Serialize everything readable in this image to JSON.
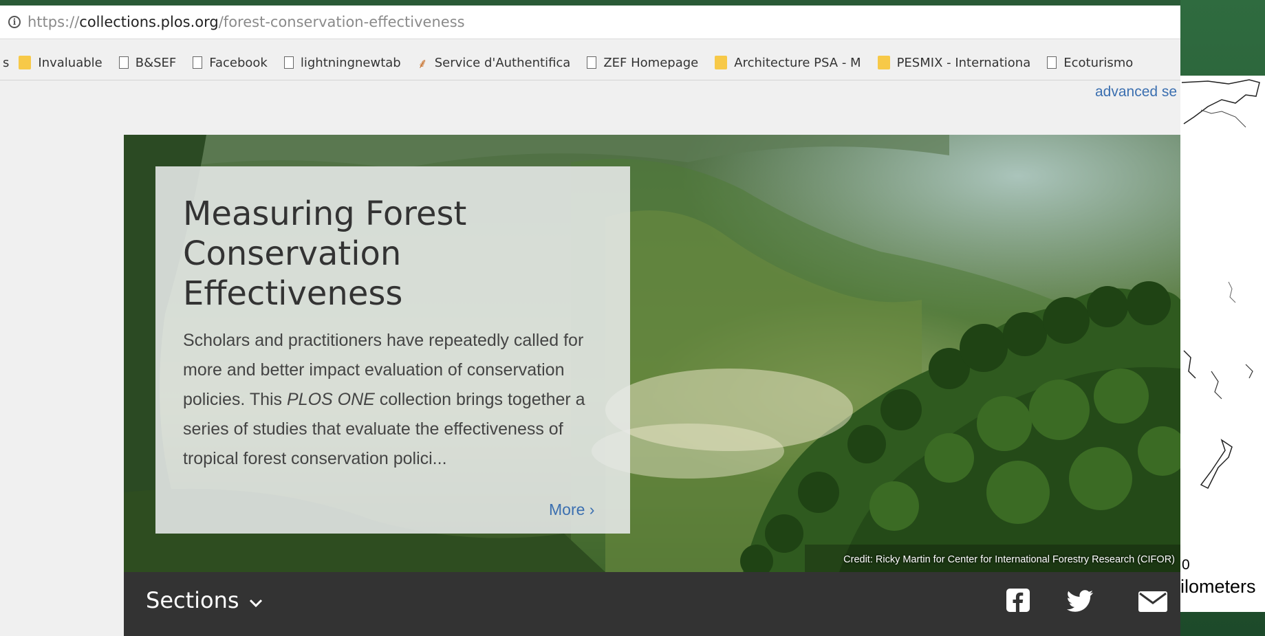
{
  "browser": {
    "url_scheme": "https://",
    "url_host": "collections.plos.org",
    "url_path": "/forest-conservation-effectiveness",
    "bookmarks": [
      {
        "label": "s",
        "icon": "none"
      },
      {
        "label": "Invaluable",
        "icon": "folder-icon"
      },
      {
        "label": "B&SEF",
        "icon": "page-icon"
      },
      {
        "label": "Facebook",
        "icon": "page-icon"
      },
      {
        "label": "lightningnewtab",
        "icon": "page-icon"
      },
      {
        "label": "Service d'Authentifica",
        "icon": "wheat-icon"
      },
      {
        "label": "ZEF Homepage",
        "icon": "page-icon"
      },
      {
        "label": "Architecture PSA - M",
        "icon": "folder-icon"
      },
      {
        "label": "PESMIX - Internationa",
        "icon": "folder-icon"
      },
      {
        "label": "Ecoturismo",
        "icon": "page-icon"
      }
    ]
  },
  "header": {
    "advanced_search": "advanced se"
  },
  "hero": {
    "title": "Measuring Forest Conservation Effectiveness",
    "body_before": "Scholars and practitioners have repeatedly called for more and better impact evaluation of conservation policies. This ",
    "body_em": "PLOS ONE",
    "body_after": " collection brings together a series of studies that evaluate the effectiveness of tropical forest conservation polici...",
    "more_label": "More ›",
    "credit": "Credit: Ricky Martin for Center for International Forestry Research (CIFOR)"
  },
  "section_bar": {
    "sections_label": "Sections",
    "share_icons": [
      "facebook-icon",
      "twitter-icon",
      "email-icon"
    ]
  },
  "map_fragment": {
    "scale_zero": "0",
    "scale_unit": "ilometers"
  },
  "colors": {
    "link": "#3b6fb0",
    "bar": "#333333",
    "backdrop": "#1f4a2c"
  }
}
